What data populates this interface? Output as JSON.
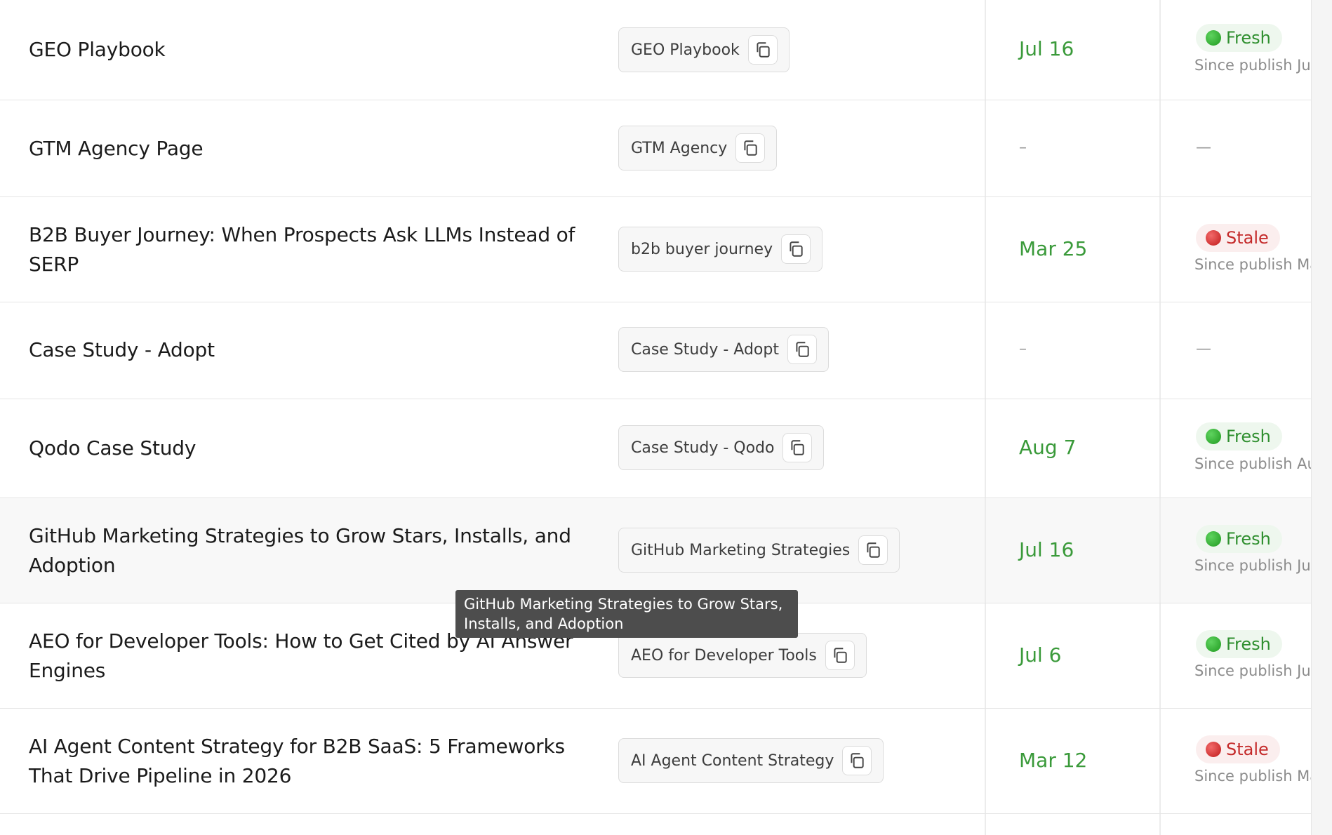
{
  "rows": [
    {
      "title": "GEO Playbook",
      "chip": "GEO Playbook",
      "date": "Jul 16",
      "status": "Fresh",
      "since": "Since publish Jul"
    },
    {
      "title": "GTM Agency Page",
      "chip": "GTM Agency",
      "date": "–",
      "status": "—",
      "since": ""
    },
    {
      "title": "B2B Buyer Journey: When Prospects Ask LLMs Instead of SERP",
      "chip": "b2b buyer journey",
      "date": "Mar 25",
      "status": "Stale",
      "since": "Since publish Ma"
    },
    {
      "title": "Case Study - Adopt",
      "chip": "Case Study - Adopt",
      "date": "–",
      "status": "—",
      "since": ""
    },
    {
      "title": "Qodo Case Study",
      "chip": "Case Study - Qodo",
      "date": "Aug 7",
      "status": "Fresh",
      "since": "Since publish Au"
    },
    {
      "title": "GitHub Marketing Strategies to Grow Stars, Installs, and Adoption",
      "chip": "GitHub Marketing Strategies",
      "date": "Jul 16",
      "status": "Fresh",
      "since": "Since publish Jul"
    },
    {
      "title": "AEO for Developer Tools: How to Get Cited by AI Answer Engines",
      "chip": "AEO for Developer Tools",
      "date": "Jul 6",
      "status": "Fresh",
      "since": "Since publish Jul"
    },
    {
      "title": "AI Agent Content Strategy for B2B SaaS: 5 Frameworks That Drive Pipeline in 2026",
      "chip": "AI Agent Content Strategy",
      "date": "Mar 12",
      "status": "Stale",
      "since": "Since publish Ma"
    }
  ],
  "tooltip": {
    "text": "GitHub Marketing Strategies to Grow Stars, Installs, and Adoption"
  },
  "icons": {
    "copy": "copy-icon",
    "fresh": "green-circle-icon",
    "stale": "red-circle-icon"
  },
  "colors": {
    "date": "#3a9a3a",
    "fresh_text": "#2f8f2f",
    "stale_text": "#c42a2a"
  }
}
